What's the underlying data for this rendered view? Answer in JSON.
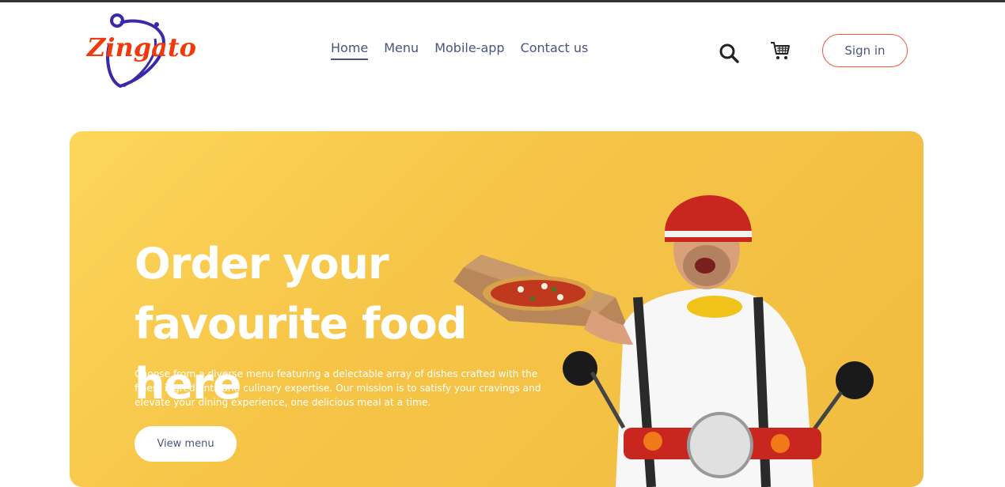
{
  "header": {
    "logo_text": "Zingato",
    "nav": [
      {
        "label": "Home",
        "active": true
      },
      {
        "label": "Menu",
        "active": false
      },
      {
        "label": "Mobile-app",
        "active": false
      },
      {
        "label": "Contact us",
        "active": false
      }
    ],
    "icons": {
      "search": "search-icon",
      "cart": "cart-icon"
    },
    "signin_label": "Sign in"
  },
  "hero": {
    "title_line1": "Order your",
    "title_line2": "favourite food here",
    "description": "Choose from a diverse menu featuring a delectable array of dishes crafted with the finest ingredients and culinary expertise. Our mission is to satisfy your cravings and elevate your dining experience, one delicious meal at a time.",
    "button_label": "View menu",
    "image": "delivery-man-with-pizza-on-scooter"
  },
  "colors": {
    "brand": "#f03a0e",
    "logo_ring": "#3a2aa8",
    "nav_text": "#49557e",
    "hero_bg": "#f6c548",
    "white": "#ffffff"
  }
}
